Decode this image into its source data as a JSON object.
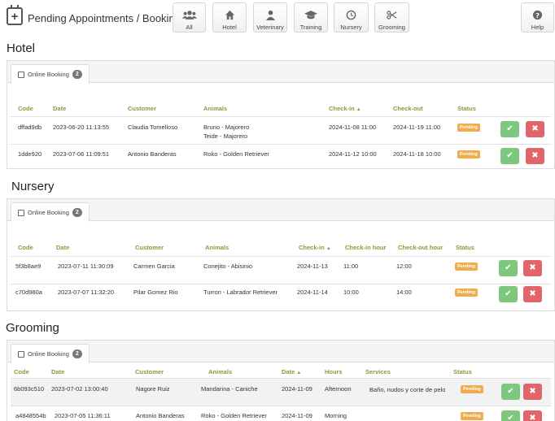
{
  "app": {
    "title": "Pending Appointments / Bookings"
  },
  "nav": [
    {
      "label": "All",
      "icon": "users-icon"
    },
    {
      "label": "Hotel",
      "icon": "home-icon"
    },
    {
      "label": "Veterinary",
      "icon": "user-md-icon"
    },
    {
      "label": "Training",
      "icon": "graduation-cap-icon"
    },
    {
      "label": "Nursery",
      "icon": "clock-icon"
    },
    {
      "label": "Grooming",
      "icon": "scissors-icon"
    }
  ],
  "help": {
    "label": "Help",
    "icon": "question-icon"
  },
  "status_colors": {
    "pending": "#f0ad4e",
    "accept": "#7dc87e",
    "reject": "#e0666b",
    "header_text": "#8a9a3a"
  },
  "hotel": {
    "title": "Hotel",
    "tab": {
      "label": "Online Booking",
      "count": "2"
    },
    "columns": [
      "Code",
      "Date",
      "Customer",
      "Animals",
      "Check-in",
      "Check-out",
      "Status"
    ],
    "rows": [
      {
        "code": "dffad9db",
        "date": "2023-06-20 11:13:55",
        "customer": "Claudia Tomelloso",
        "animals": [
          "Bruno - Majorero",
          "Teide - Majorero"
        ],
        "checkin": "2024-11-08 11:00",
        "checkout": "2024-11-19 11:00",
        "status": "Pending"
      },
      {
        "code": "1dde920",
        "date": "2023-07-06 11:09:51",
        "customer": "Antonio Banderas",
        "animals": [
          "Roko - Golden Retriever"
        ],
        "checkin": "2024-11-12 10:00",
        "checkout": "2024-11-18 10:00",
        "status": "Pending"
      }
    ]
  },
  "nursery": {
    "title": "Nursery",
    "tab": {
      "label": "Online Booking",
      "count": "2"
    },
    "columns": [
      "Code",
      "Date",
      "Customer",
      "Animals",
      "Check-in",
      "Check-in hour",
      "Check-out hour",
      "Status"
    ],
    "rows": [
      {
        "code": "5f3b8ae9",
        "date": "2023-07-11 11:30:09",
        "customer": "Carmen Garcia",
        "animals": "Conejito - Abisinio",
        "checkin": "2024-11-13",
        "checkin_hour": "11:00",
        "checkout_hour": "12:00",
        "status": "Pending"
      },
      {
        "code": "c70d980a",
        "date": "2023-07-07 11:32:20",
        "customer": "Pilar Gomez Rio",
        "animals": "Turron - Labrador Retriever",
        "checkin": "2024-11-14",
        "checkin_hour": "10:00",
        "checkout_hour": "14:00",
        "status": "Pending"
      }
    ]
  },
  "grooming": {
    "title": "Grooming",
    "tab": {
      "label": "Online Booking",
      "count": "2"
    },
    "columns": [
      "Code",
      "Date",
      "Customer",
      "Animals",
      "Date",
      "Hours",
      "Services",
      "Status"
    ],
    "rows": [
      {
        "code": "6b093c510",
        "date": "2023-07-02  13:00:40",
        "customer": "Nagore Ruiz",
        "animals": "Mandarina -  Caniche",
        "appt_date": "2024-11-09",
        "hours": "Afternoon",
        "services": "Baño, nudos y corte de pelo",
        "status": "Pending"
      },
      {
        "code": "a4848554b",
        "date": "2023-07-05 11:36:11",
        "customer": "Antonio Banderas",
        "animals": "Roko - Golden  Retriever",
        "appt_date": "2024-11-09",
        "hours": "Morning",
        "services": "",
        "status": "Pending"
      }
    ]
  }
}
